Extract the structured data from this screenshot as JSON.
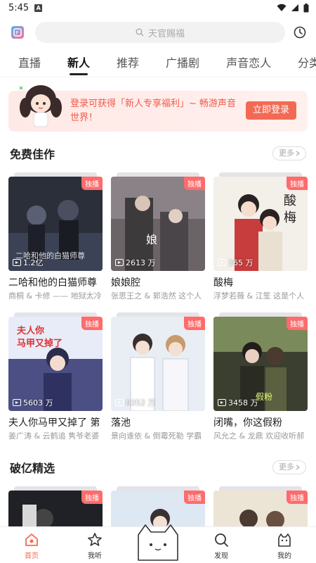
{
  "status": {
    "time": "5:45"
  },
  "search": {
    "placeholder": "天官赐福"
  },
  "tabs": [
    {
      "label": "直播"
    },
    {
      "label": "新人"
    },
    {
      "label": "推荐"
    },
    {
      "label": "广播剧"
    },
    {
      "label": "声音恋人"
    },
    {
      "label": "分类"
    }
  ],
  "banner": {
    "text": "登录可获得「新人专享福利」~ 畅游声音世界！",
    "button": "立即登录"
  },
  "sections": [
    {
      "title": "免费佳作",
      "more": "更多",
      "cards": [
        {
          "badge": "独播",
          "plays": "1.2亿",
          "title": "二哈和他的白猫师尊",
          "sub": "商桐 & 卡修 —— 地狱太冷",
          "cover": "#2b2f3a"
        },
        {
          "badge": "独播",
          "plays": "2613 万",
          "title": "娘娘腔",
          "sub": "张思王之 & 郭浩然 这个人",
          "cover": "#6a6466"
        },
        {
          "badge": "独播",
          "plays": "265 万",
          "title": "酸梅",
          "sub": "浮梦若薇 & 江笙 这是个人",
          "cover": "#f3efe9"
        },
        {
          "badge": "独播",
          "plays": "5603 万",
          "title": "夫人你马甲又掉了 第",
          "sub": "姜广涛 & 云鹤追 隽爷老婆",
          "cover": "#4c4f84"
        },
        {
          "badge": "独播",
          "plays": "6352 万",
          "title": "落池",
          "sub": "景向谁依 & 倒霉死勒 学霸",
          "cover": "#e8eef4"
        },
        {
          "badge": "独播",
          "plays": "3458 万",
          "title": "闭嘴，你这假粉",
          "sub": "风允之 & 龙鼎 欢迎收听郝",
          "cover": "#3b3f2f"
        }
      ]
    },
    {
      "title": "破亿精选",
      "more": "更多",
      "cards": [
        {
          "badge": "独播",
          "cover": "#1f2126"
        },
        {
          "badge": "独播",
          "cover": "#dde8f3"
        },
        {
          "badge": "独播",
          "cover": "#ece5d5"
        }
      ]
    }
  ],
  "bottom_nav": [
    {
      "label": "首页",
      "icon": "home-icon",
      "active": true
    },
    {
      "label": "我听",
      "icon": "star-icon"
    },
    {
      "label": "",
      "icon": "cat-icon"
    },
    {
      "label": "发现",
      "icon": "search-icon"
    },
    {
      "label": "我的",
      "icon": "profile-cat-icon"
    }
  ],
  "colors": {
    "accent": "#f26a55",
    "badge": "#ff6b6b",
    "banner_bg": "#ffeae7"
  }
}
